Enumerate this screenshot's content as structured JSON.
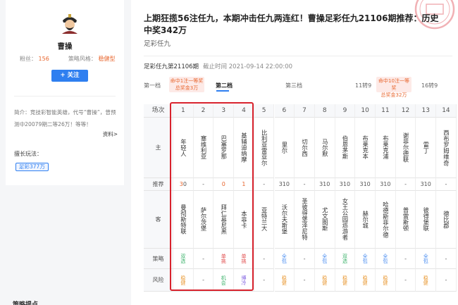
{
  "author": {
    "name": "曹操",
    "fans_label": "粉丝：",
    "fans": "156",
    "style_label": "策略风格：",
    "style": "稳健型",
    "follow_label": "+ 关注",
    "bio": "简介：竞技彩智能英雄，代号“曹操”，曾预测中20079期二等26万！等等！",
    "more_label": "资料>",
    "skill_label": "擅长玩法：",
    "skill_tag": "足彩377万"
  },
  "article": {
    "title": "上期狂揽56注任九，本期冲击任九两连红！曹操足彩任九21106期推荐：历史中奖342万",
    "category": "足彩任九",
    "issue": "足彩任九第21106期",
    "deadline": "截止时间 2021-09-14 22:00:00"
  },
  "tabs": [
    {
      "label": "第一档"
    },
    {
      "label": "第二档",
      "active": true
    },
    {
      "label": "第三档"
    },
    {
      "label": "11转9"
    },
    {
      "label": "16转9"
    }
  ],
  "prizes": [
    {
      "line1": "命中1注一等奖",
      "line2": "总奖金3万"
    },
    {
      "line1": "命中10注一等奖",
      "line2": "总奖金32万"
    }
  ],
  "table": {
    "row_labels": {
      "index": "场次",
      "home": "主",
      "rec": "推荐",
      "away": "客",
      "strategy": "策略",
      "risk": "风险"
    },
    "matches": [
      {
        "n": "1",
        "home": "年轻人",
        "rec": "30",
        "hit": "3",
        "away": "曼彻斯特联",
        "strategy": "双选",
        "strategy_color": "#3bb26a",
        "risk": "稳健",
        "risk_color": "#e8962e"
      },
      {
        "n": "2",
        "home": "塞维利亚",
        "rec": "-",
        "hit": "",
        "away": "萨尔茨堡",
        "strategy": "-",
        "strategy_color": "#555555",
        "risk": "-",
        "risk_color": "#555555"
      },
      {
        "n": "3",
        "home": "巴塞罗那",
        "rec": "0",
        "hit": "0",
        "away": "拜仁慕尼黑",
        "strategy": "单挑",
        "strategy_color": "#e04b4b",
        "risk": "机会",
        "risk_color": "#3bb26a"
      },
      {
        "n": "4",
        "home": "基辅迪纳摩",
        "rec": "1",
        "hit": "1",
        "away": "本菲卡",
        "strategy": "单挑",
        "strategy_color": "#e04b4b",
        "risk": "博冷",
        "risk_color": "#7c5ce0"
      },
      {
        "n": "5",
        "home": "比利亚雷亚尔",
        "rec": "-",
        "hit": "",
        "away": "亚特兰大",
        "strategy": "-",
        "strategy_color": "#555555",
        "risk": "-",
        "risk_color": "#555555"
      },
      {
        "n": "6",
        "home": "里尔",
        "rec": "310",
        "hit": "",
        "away": "沃尔夫斯堡",
        "strategy": "全包",
        "strategy_color": "#4a8df0",
        "risk": "稳健",
        "risk_color": "#e8962e"
      },
      {
        "n": "7",
        "home": "切尔西",
        "rec": "-",
        "hit": "",
        "away": "圣彼得堡泽尼特",
        "strategy": "-",
        "strategy_color": "#555555",
        "risk": "-",
        "risk_color": "#555555"
      },
      {
        "n": "8",
        "home": "马尔默",
        "rec": "310",
        "hit": "",
        "away": "尤文图斯",
        "strategy": "全包",
        "strategy_color": "#4a8df0",
        "risk": "稳健",
        "risk_color": "#e8962e"
      },
      {
        "n": "9",
        "home": "伯恩茅斯",
        "rec": "310",
        "hit": "",
        "away": "女王公园巡游者",
        "strategy": "双选",
        "strategy_color": "#3bb26a",
        "risk": "稳健",
        "risk_color": "#e8962e"
      },
      {
        "n": "10",
        "home": "布莱克本",
        "rec": "310",
        "hit": "",
        "away": "赫尔城",
        "strategy": "全包",
        "strategy_color": "#4a8df0",
        "risk": "稳健",
        "risk_color": "#e8962e"
      },
      {
        "n": "11",
        "home": "布莱克浦",
        "rec": "310",
        "hit": "",
        "away": "哈德斯菲尔德",
        "strategy": "全包",
        "strategy_color": "#4a8df0",
        "risk": "稳健",
        "risk_color": "#e8962e"
      },
      {
        "n": "12",
        "home": "谢菲尔德联",
        "rec": "-",
        "hit": "",
        "away": "普雷斯顿",
        "strategy": "-",
        "strategy_color": "#555555",
        "risk": "-",
        "risk_color": "#555555"
      },
      {
        "n": "13",
        "home": "雷丁",
        "rec": "310",
        "hit": "",
        "away": "彼得堡联",
        "strategy": "全包",
        "strategy_color": "#4a8df0",
        "risk": "稳健",
        "risk_color": "#e8962e"
      },
      {
        "n": "14",
        "home": "西布罗姆维奇",
        "rec": "-",
        "hit": "",
        "away": "德比郡",
        "strategy": "-",
        "strategy_color": "#555555",
        "risk": "-",
        "risk_color": "#555555"
      }
    ]
  },
  "section_next": "策略提点"
}
